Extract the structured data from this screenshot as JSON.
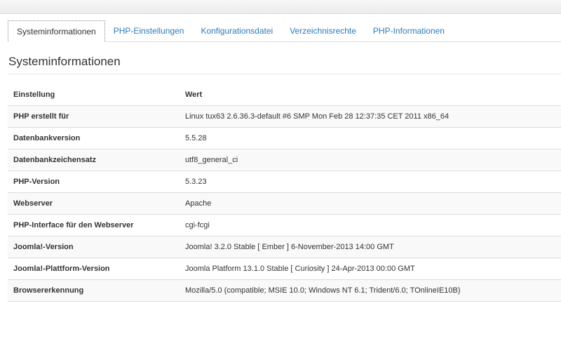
{
  "tabs": [
    {
      "label": "Systeminformationen",
      "active": true
    },
    {
      "label": "PHP-Einstellungen",
      "active": false
    },
    {
      "label": "Konfigurationsdatei",
      "active": false
    },
    {
      "label": "Verzeichnisrechte",
      "active": false
    },
    {
      "label": "PHP-Informationen",
      "active": false
    }
  ],
  "page_title": "Systeminformationen",
  "table": {
    "headers": [
      "Einstellung",
      "Wert"
    ],
    "rows": [
      {
        "key": "PHP erstellt für",
        "value": "Linux tux63 2.6.36.3-default #6 SMP Mon Feb 28 12:37:35 CET 2011 x86_64"
      },
      {
        "key": "Datenbankversion",
        "value": "5.5.28"
      },
      {
        "key": "Datenbankzeichensatz",
        "value": "utf8_general_ci"
      },
      {
        "key": "PHP-Version",
        "value": "5.3.23"
      },
      {
        "key": "Webserver",
        "value": "Apache"
      },
      {
        "key": "PHP-Interface für den Webserver",
        "value": "cgi-fcgi"
      },
      {
        "key": "Joomla!-Version",
        "value": "Joomla! 3.2.0 Stable [ Ember ] 6-November-2013 14:00 GMT"
      },
      {
        "key": "Joomla!-Plattform-Version",
        "value": "Joomla Platform 13.1.0 Stable [ Curiosity ] 24-Apr-2013 00:00 GMT"
      },
      {
        "key": "Browsererkennung",
        "value": "Mozilla/5.0 (compatible; MSIE 10.0; Windows NT 6.1; Trident/6.0; TOnlineIE10B)"
      }
    ]
  },
  "colors": {
    "link": "#2a7bbd",
    "text": "#333333",
    "row_stripe": "#f9f9f9",
    "border": "#dddddd"
  }
}
